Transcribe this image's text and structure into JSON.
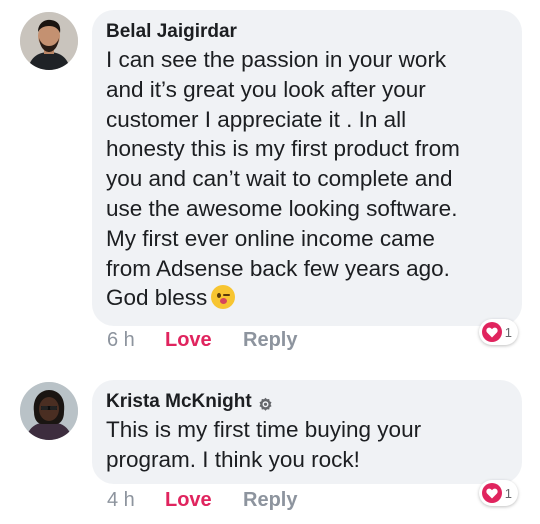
{
  "comments": [
    {
      "author": "Belal Jaigirdar",
      "text": "I can see the passion in your work\nand it’s great you look after your\ncustomer I appreciate it . In all\nhonesty this is my first product from\nyou and can’t wait to complete and\nuse the awesome looking software.\nMy first ever online income came\nfrom Adsense back few years ago.\nGod bless",
      "emoji": "kissing-wink-emoji",
      "time": "6 h",
      "love_label": "Love",
      "reply_label": "Reply",
      "reaction_count": "1"
    },
    {
      "author": "Krista McKnight",
      "text": "This is my first time buying your\nprogram.  I think you rock!",
      "time": "4 h",
      "love_label": "Love",
      "reply_label": "Reply",
      "reaction_count": "1"
    }
  ],
  "colors": {
    "bubble": "#f0f2f5",
    "love": "#e0245e",
    "muted": "#8d949e"
  }
}
